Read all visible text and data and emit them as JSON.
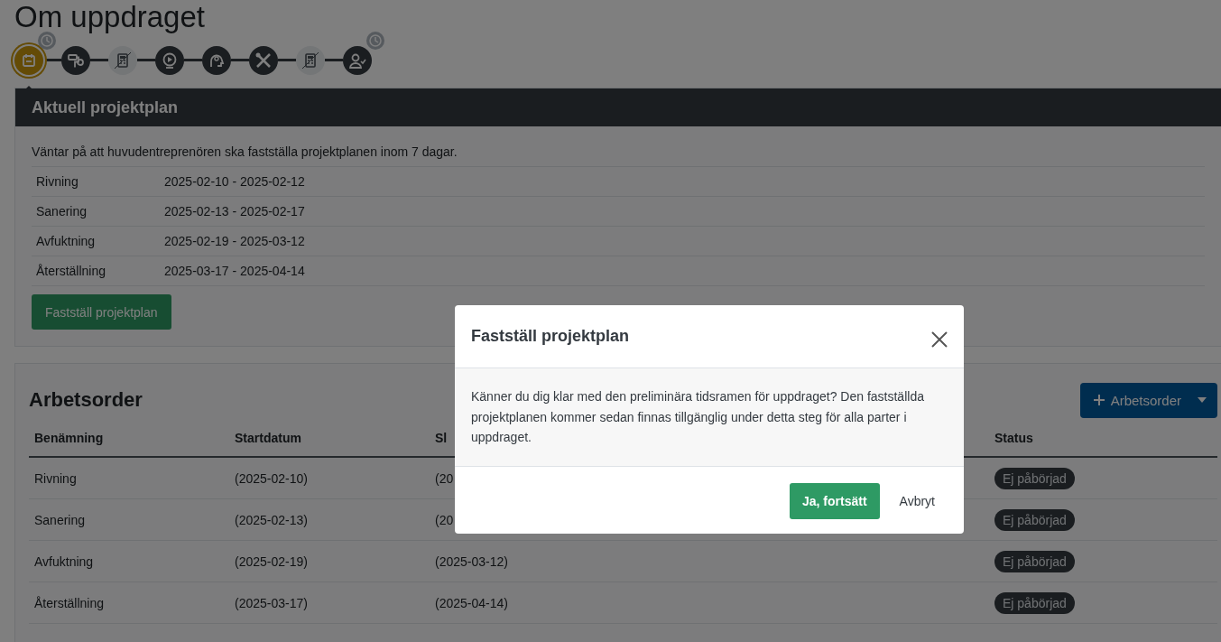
{
  "page_title": "Om uppdraget",
  "steps": [
    {
      "selected": true,
      "disabled": false,
      "pending": true
    },
    {
      "selected": false,
      "disabled": false,
      "pending": false
    },
    {
      "selected": false,
      "disabled": true,
      "pending": false
    },
    {
      "selected": false,
      "disabled": false,
      "pending": false
    },
    {
      "selected": false,
      "disabled": false,
      "pending": false
    },
    {
      "selected": false,
      "disabled": false,
      "pending": false
    },
    {
      "selected": false,
      "disabled": true,
      "pending": false
    },
    {
      "selected": false,
      "disabled": false,
      "pending": true
    }
  ],
  "plan": {
    "title": "Aktuell projektplan",
    "notice": "Väntar på att huvudentreprenören ska fastställa projektplanen inom 7 dagar.",
    "rows": [
      {
        "name": "Rivning",
        "period": "2025-02-10 - 2025-02-12"
      },
      {
        "name": "Sanering",
        "period": "2025-02-13 - 2025-02-17"
      },
      {
        "name": "Avfuktning",
        "period": "2025-02-19 - 2025-03-12"
      },
      {
        "name": "Återställning",
        "period": "2025-03-17 - 2025-04-14"
      }
    ],
    "button": "Fastställ projektplan"
  },
  "orders": {
    "title": "Arbetsorder",
    "add_button": "Arbetsorder",
    "columns": [
      "Benämning",
      "Startdatum",
      "Sl",
      "Status"
    ],
    "rows": [
      {
        "name": "Rivning",
        "start": "(2025-02-10)",
        "column_3": "(20",
        "status": "Ej påbörjad"
      },
      {
        "name": "Sanering",
        "start": "(2025-02-13)",
        "column_3": "(20",
        "status": "Ej påbörjad"
      },
      {
        "name": "Avfuktning",
        "start": "(2025-02-19)",
        "column_3": "(2025-03-12)",
        "status": "Ej påbörjad"
      },
      {
        "name": "Återställning",
        "start": "(2025-03-17)",
        "column_3": "(2025-04-14)",
        "status": "Ej påbörjad"
      }
    ]
  },
  "modal": {
    "title": "Fastställ projektplan",
    "text": "Känner du dig klar med den preliminära tidsramen för uppdraget? Den fastställda projektplanen kommer sedan finnas tillgänglig under detta steg för alla parter i uppdraget.",
    "confirm": "Ja, fortsätt",
    "cancel": "Avbryt"
  }
}
